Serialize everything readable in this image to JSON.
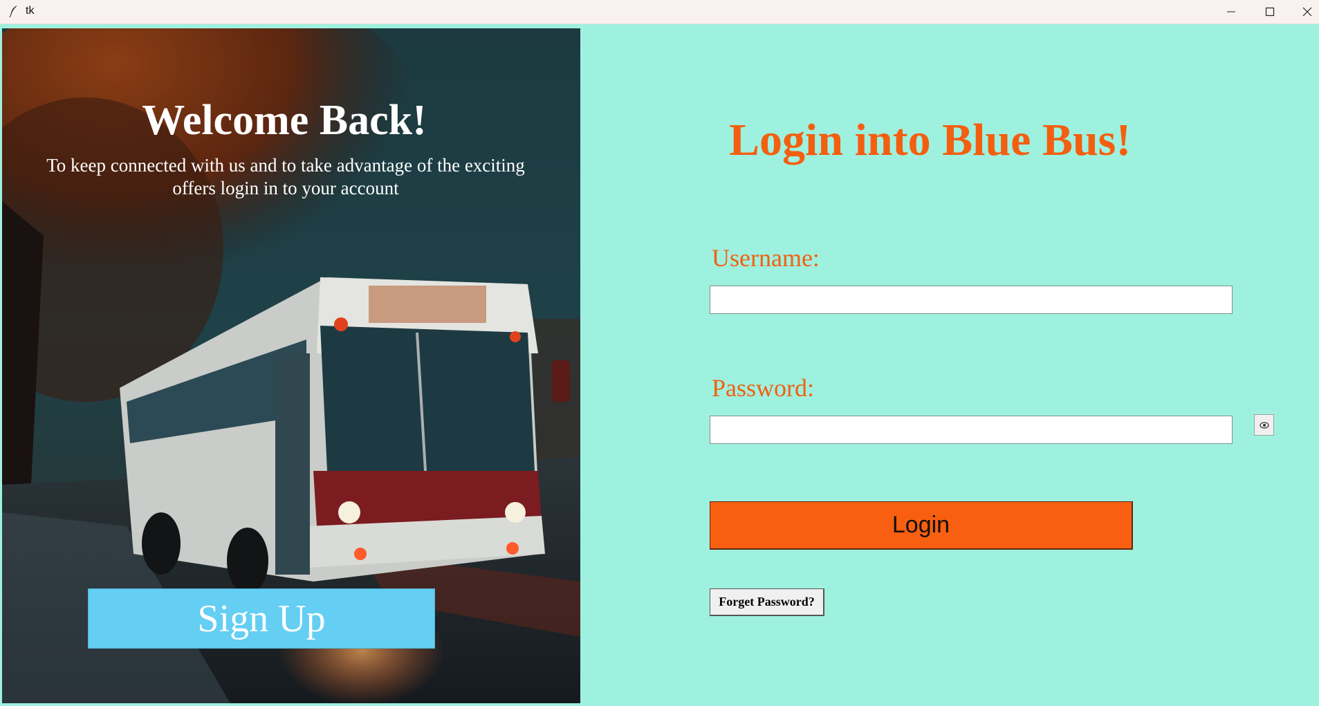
{
  "window": {
    "title": "tk",
    "minimize_glyph": "–",
    "maximize_glyph": "☐",
    "close_glyph": "✕"
  },
  "left_panel": {
    "heading": "Welcome Back!",
    "subtitle": "To keep connected with us and to take advantage of the exciting offers login in to your account",
    "signup_label": "Sign Up",
    "signup_color": "#64cef3"
  },
  "right_panel": {
    "heading": "Login into Blue Bus!",
    "username_label": "Username:",
    "username_value": "",
    "password_label": "Password:",
    "password_value": "",
    "login_label": "Login",
    "forget_label": "Forget Password?",
    "accent_color": "#f35f10",
    "background_color": "#9ff1df",
    "show_password_icon": "eye-icon"
  }
}
